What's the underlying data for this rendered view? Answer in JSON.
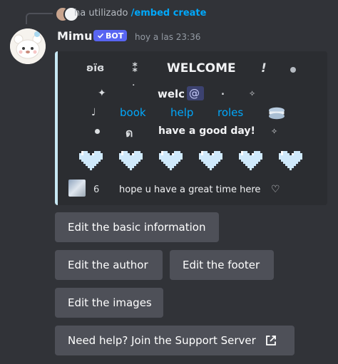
{
  "reply": {
    "text": "ha utilizado",
    "command": "/embed create"
  },
  "message": {
    "username": "Mimu",
    "bot_label": "BOT",
    "timestamp": "hoy a las 23:36"
  },
  "embed": {
    "accent_color": "#c7e8f4",
    "row1": {
      "left": "ʚїɞ",
      "sym": "⁑",
      "title": "WELCOME",
      "bang": "!"
    },
    "row2": {
      "sparkle": "✦",
      "tick": "˙",
      "text": "welc",
      "at": "@",
      "period": ".",
      "star": "✧"
    },
    "row3": {
      "note": "♩",
      "link1": "book",
      "link2": "help",
      "link3": "roles"
    },
    "row4": {
      "glyph": "ด",
      "text": "have a good day!",
      "star": "✧"
    },
    "hearts_count": 6,
    "footer": {
      "num": "6",
      "text": "hope u have a great time here",
      "heart": "♡"
    }
  },
  "buttons": {
    "basic_info": "Edit the basic information",
    "author": "Edit the author",
    "footer": "Edit the footer",
    "images": "Edit the images",
    "support": "Need help? Join the Support Server"
  }
}
